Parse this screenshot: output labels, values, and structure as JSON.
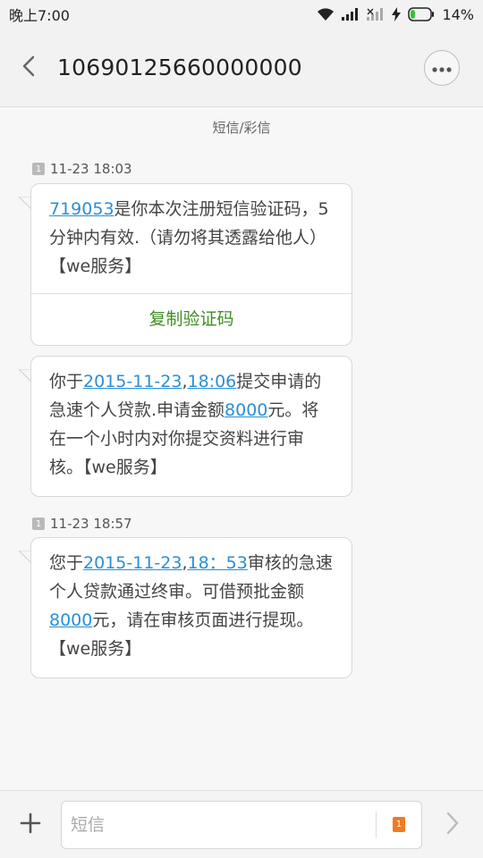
{
  "status_bar": {
    "time": "晚上7:00",
    "battery_percent": "14%",
    "icons": [
      "wifi-icon",
      "signal-icon",
      "signal-empty-icon",
      "charging-icon",
      "battery-icon"
    ]
  },
  "header": {
    "title": "10690125660000000",
    "back_icon": "chevron-left-icon",
    "more_icon": "more-dots-icon"
  },
  "conversation": {
    "type_label": "短信/彩信",
    "groups": [
      {
        "sim": "1",
        "timestamp": "11-23 18:03",
        "messages": [
          {
            "parts": {
              "p0": "719053",
              "p1": "是你本次注册短信验证码，5分钟内有效.（请勿将其透露给他人）【we服务】"
            },
            "action_label": "复制验证码"
          },
          {
            "parts": {
              "p0": "你于",
              "p1": "2015-11-23",
              "p2": ",",
              "p3": "18:06",
              "p4": "提交申请的急速个人贷款.申请金额",
              "p5": "8000",
              "p6": "元。将在一个小时内对你提交资料进行审核。【we服务】"
            }
          }
        ]
      },
      {
        "sim": "1",
        "timestamp": "11-23 18:57",
        "messages": [
          {
            "parts": {
              "p0": "您于",
              "p1": "2015-11-23",
              "p2": ",",
              "p3": "18：53",
              "p4": "审核的急速个人贷款通过终审。可借预批金额",
              "p5": "8000",
              "p6": "元，请在审核页面进行提现。【we服务】"
            }
          }
        ]
      }
    ]
  },
  "input_bar": {
    "placeholder": "短信",
    "value": "",
    "sim": "1",
    "add_icon": "plus-icon",
    "send_icon": "chevron-right-icon"
  },
  "colors": {
    "link": "#2a8fd8",
    "action_green": "#3f8e23",
    "sim_orange": "#f07b22",
    "background": "#f7f7f7"
  }
}
